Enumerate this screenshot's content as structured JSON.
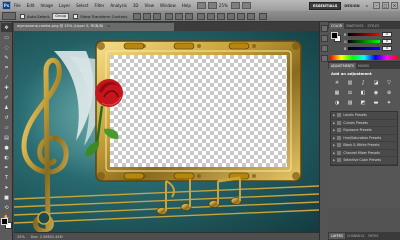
{
  "app": {
    "logo": "Ps"
  },
  "menu": [
    "File",
    "Edit",
    "Image",
    "Layer",
    "Select",
    "Filter",
    "Analysis",
    "3D",
    "View",
    "Window",
    "Help"
  ],
  "zoom": "25%",
  "workspaces": {
    "active": "ESSENTIALS",
    "other": "DESIGN",
    "more": "»"
  },
  "options": {
    "auto_select_label": "Auto-Select:",
    "auto_select_value": "Group",
    "transform_label": "Show Transform Controls"
  },
  "document": {
    "tab_title": "wymarzona-ramka.png @ 25% (Layer 0, RGB/8)",
    "close": "×"
  },
  "status": {
    "zoom": "25%",
    "doc": "Doc: 2.58M/2.44M"
  },
  "color_panel": {
    "tabs": [
      "COLOR",
      "SWATCHES",
      "STYLES"
    ],
    "channels": [
      {
        "label": "R",
        "value": "0",
        "color": "#ff0000"
      },
      {
        "label": "G",
        "value": "0",
        "color": "#00ff00"
      },
      {
        "label": "B",
        "value": "0",
        "color": "#0000ff"
      }
    ]
  },
  "adjust_panel": {
    "tabs": [
      "ADJUSTMENTS",
      "MASKS"
    ],
    "title": "Add an adjustment",
    "presets": [
      "Levels Presets",
      "Curves Presets",
      "Exposure Presets",
      "Hue/Saturation Presets",
      "Black & White Presets",
      "Channel Mixer Presets",
      "Selective Color Presets"
    ]
  },
  "layers_tabs": [
    "LAYERS",
    "CHANNELS",
    "PATHS"
  ],
  "colors": {
    "accent": "#1c3e73",
    "teal_bg": "#2a6d72",
    "gold": "#c9a33b",
    "rose": "#c4161c"
  }
}
